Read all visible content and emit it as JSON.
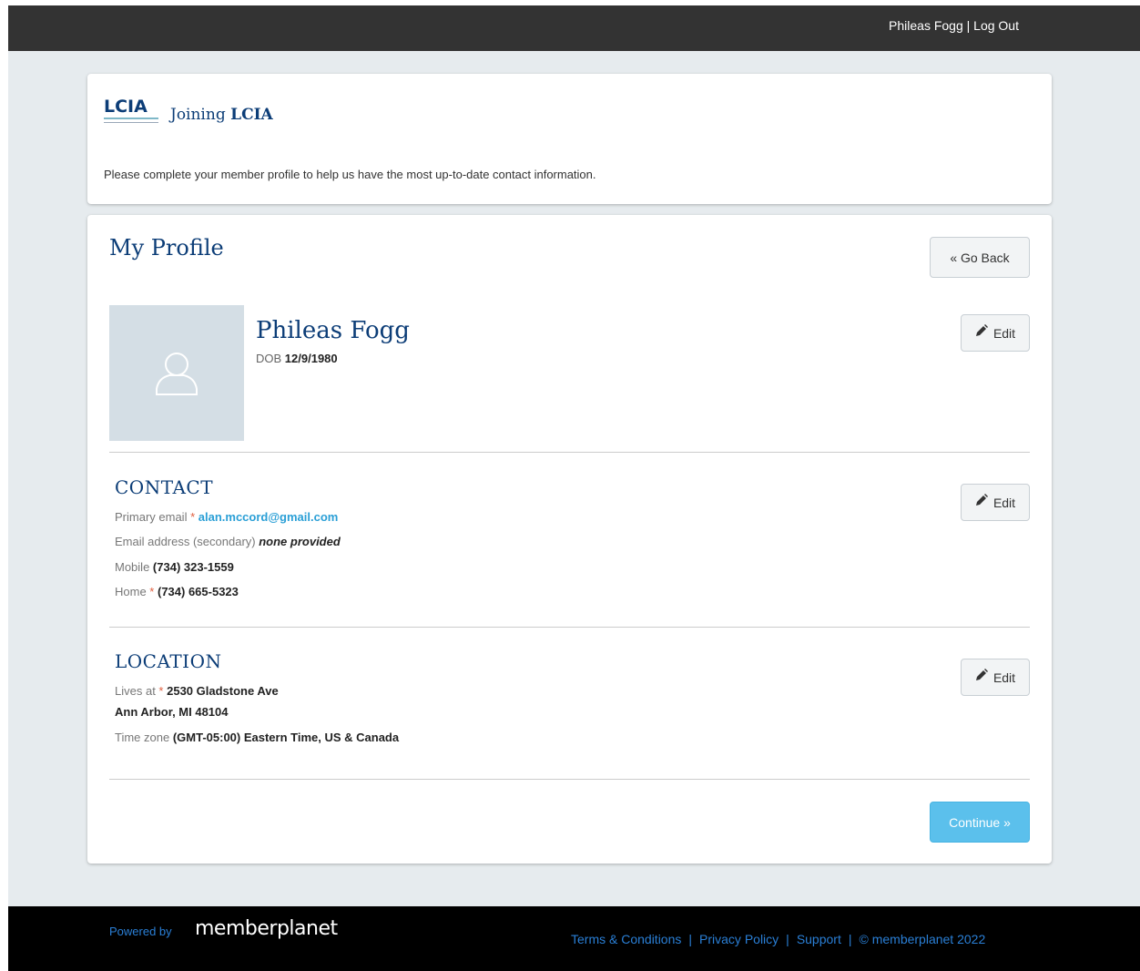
{
  "topbar": {
    "user_name": "Phileas Fogg",
    "separator": " | ",
    "logout": "Log Out"
  },
  "header_card": {
    "logo_text": "LCIA",
    "joining_prefix": "Joining ",
    "joining_org": "LCIA",
    "intro": "Please complete your member profile to help us have the most up-to-date contact information."
  },
  "profile": {
    "title": "My Profile",
    "go_back": "« Go Back",
    "name": "Phileas Fogg",
    "dob_label": "DOB ",
    "dob_value": "12/9/1980",
    "edit_label": "Edit"
  },
  "contact": {
    "title": "CONTACT",
    "primary_email_label": "Primary email ",
    "primary_email_value": "alan.mccord@gmail.com",
    "secondary_email_label": "Email address (secondary) ",
    "secondary_email_value": "none provided",
    "mobile_label": "Mobile ",
    "mobile_value": "(734) 323-1559",
    "home_label": "Home ",
    "home_value": "(734) 665-5323"
  },
  "location": {
    "title": "LOCATION",
    "lives_label": "Lives at ",
    "address_line1": "2530 Gladstone Ave",
    "address_line2": "Ann Arbor, MI 48104",
    "timezone_label": "Time zone ",
    "timezone_value": "(GMT-05:00) Eastern Time, US & Canada"
  },
  "continue_label": "Continue »",
  "required_mark": "*",
  "footer": {
    "powered_by": "Powered by",
    "brand": "memberplanet",
    "links": [
      "Terms & Conditions",
      "Privacy Policy",
      "Support",
      "© memberplanet 2022"
    ]
  },
  "colors": {
    "topbar": "#333333",
    "page_bg": "#e6ebee",
    "heading": "#0c3d77",
    "link": "#2a9fd6",
    "continue_button": "#5bc0ec",
    "footer": "#000000"
  },
  "icons": [
    "user-icon",
    "pencil-icon"
  ]
}
